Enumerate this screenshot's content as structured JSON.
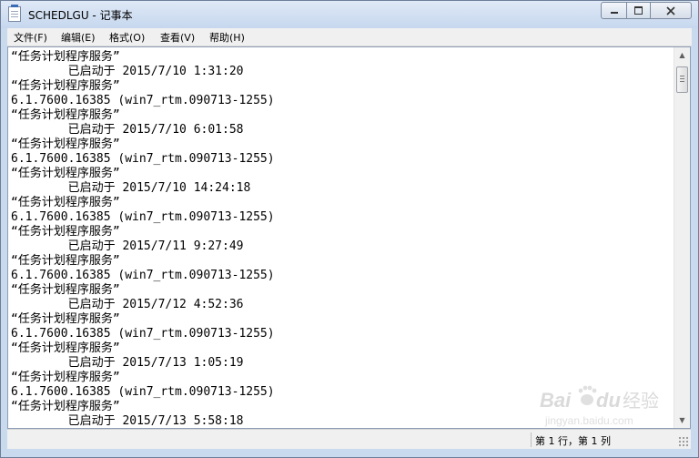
{
  "window": {
    "title": "SCHEDLGU - 记事本"
  },
  "menu": {
    "items": [
      "文件(F)",
      "编辑(E)",
      "格式(O)",
      "查看(V)",
      "帮助(H)"
    ]
  },
  "document": {
    "lines": [
      "“任务计划程序服务”",
      "        已启动于 2015/7/10 1:31:20",
      "“任务计划程序服务”",
      "6.1.7600.16385 (win7_rtm.090713-1255)",
      "“任务计划程序服务”",
      "        已启动于 2015/7/10 6:01:58",
      "“任务计划程序服务”",
      "6.1.7600.16385 (win7_rtm.090713-1255)",
      "“任务计划程序服务”",
      "        已启动于 2015/7/10 14:24:18",
      "“任务计划程序服务”",
      "6.1.7600.16385 (win7_rtm.090713-1255)",
      "“任务计划程序服务”",
      "        已启动于 2015/7/11 9:27:49",
      "“任务计划程序服务”",
      "6.1.7600.16385 (win7_rtm.090713-1255)",
      "“任务计划程序服务”",
      "        已启动于 2015/7/12 4:52:36",
      "“任务计划程序服务”",
      "6.1.7600.16385 (win7_rtm.090713-1255)",
      "“任务计划程序服务”",
      "        已启动于 2015/7/13 1:05:19",
      "“任务计划程序服务”",
      "6.1.7600.16385 (win7_rtm.090713-1255)",
      "“任务计划程序服务”",
      "        已启动于 2015/7/13 5:58:18"
    ]
  },
  "status": {
    "position": "第 1 行，第 1 列"
  },
  "watermark": {
    "brand": "Bai",
    "brand2": "du",
    "suffix": "经验",
    "url": "jingyan.baidu.com"
  },
  "icons": {
    "app": "notepad-icon",
    "minimize": "minimize-icon",
    "maximize": "maximize-icon",
    "close": "close-icon",
    "scroll_up": "scroll-up-arrow-icon",
    "scroll_down": "scroll-down-arrow-icon",
    "grip": "resize-grip-icon"
  }
}
